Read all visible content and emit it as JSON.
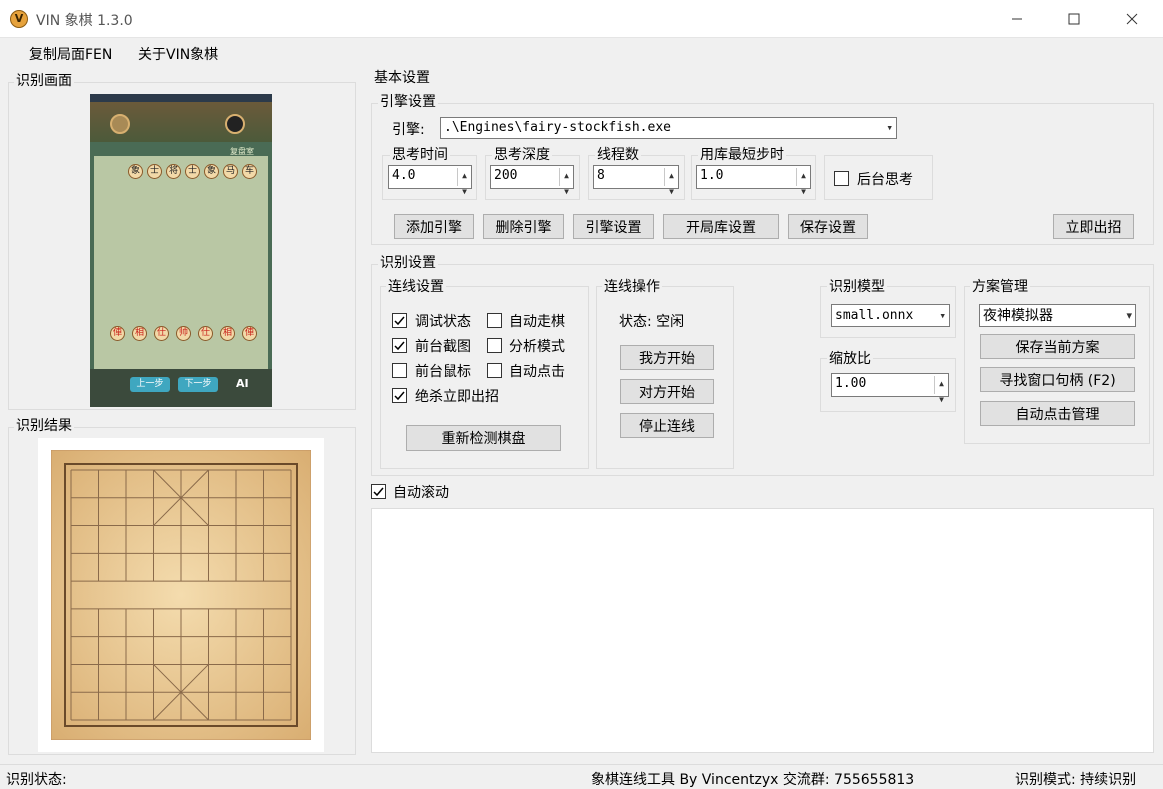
{
  "window": {
    "title": "VIN 象棋 1.3.0",
    "logo": "V"
  },
  "menu": [
    "复制局面FEN",
    "关于VIN象棋"
  ],
  "left": {
    "capture_title": "识别画面",
    "result_title": "识别结果"
  },
  "phone": {
    "btn_prev": "上一步",
    "btn_next": "下一步",
    "ai": "AI",
    "tag": "复盘室",
    "pieces_top": [
      "象",
      "士",
      "将",
      "士",
      "象",
      "马",
      "车"
    ],
    "pieces_bottom": [
      "俥",
      "相",
      "仕",
      "帅",
      "仕",
      "相",
      "俥"
    ]
  },
  "basic": {
    "title": "基本设置",
    "engine_group": "引擎设置",
    "engine_label": "引擎:",
    "engine_value": ".\\Engines\\fairy-stockfish.exe",
    "think_time_label": "思考时间",
    "think_time_value": "4.0",
    "depth_label": "思考深度",
    "depth_value": "200",
    "threads_label": "线程数",
    "threads_value": "8",
    "book_label": "用库最短步时",
    "book_value": "1.0",
    "bg_think_label": "后台思考",
    "buttons": {
      "add": "添加引擎",
      "delete": "删除引擎",
      "engine_settings": "引擎设置",
      "book_settings": "开局库设置",
      "save": "保存设置",
      "move_now": "立即出招"
    }
  },
  "recog": {
    "title": "识别设置",
    "link_group": "连线设置",
    "checks": {
      "debug": "调试状态",
      "auto_move": "自动走棋",
      "front_capture": "前台截图",
      "analyze": "分析模式",
      "front_mouse": "前台鼠标",
      "auto_click": "自动点击",
      "kill_move": "绝杀立即出招"
    },
    "redetect": "重新检测棋盘",
    "op_group": "连线操作",
    "status": "状态: 空闲",
    "op_buttons": {
      "my_start": "我方开始",
      "opp_start": "对方开始",
      "stop": "停止连线"
    },
    "model_group": "识别模型",
    "model_value": "small.onnx",
    "scale_group": "缩放比",
    "scale_value": "1.00",
    "scheme_group": "方案管理",
    "scheme_value": "夜神模拟器",
    "scheme_buttons": {
      "save": "保存当前方案",
      "find": "寻找窗口句柄 (F2)",
      "auto_click": "自动点击管理"
    }
  },
  "autoscroll": "自动滚动",
  "status": {
    "left": "识别状态:",
    "center": "象棋连线工具 By Vincentzyx 交流群: 755655813",
    "right": "识别模式: 持续识别"
  }
}
